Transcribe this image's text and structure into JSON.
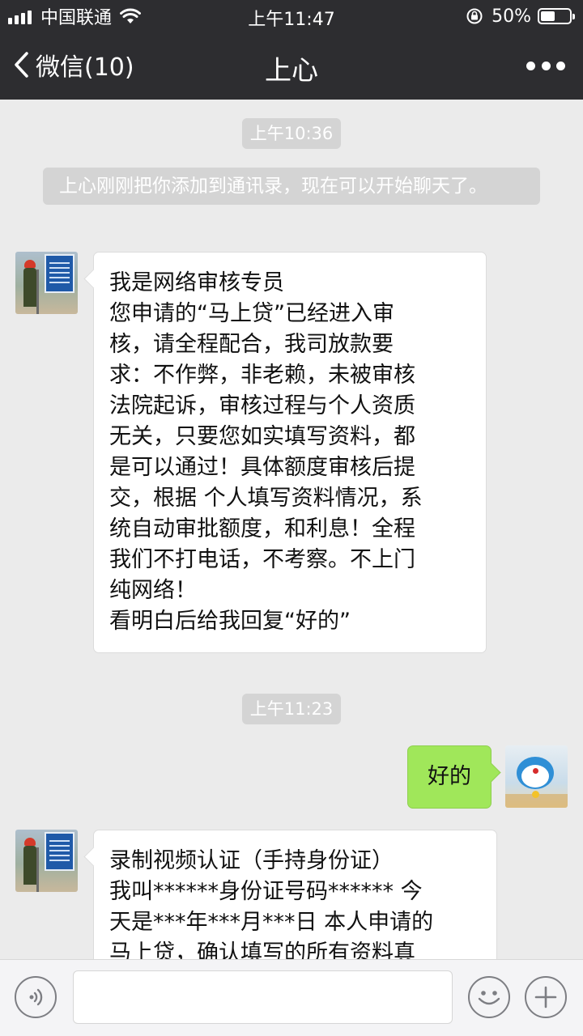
{
  "status_bar": {
    "carrier": "中国联通",
    "time": "上午11:47",
    "battery_percent": "50%",
    "battery_level": 0.5,
    "icons": [
      "signal-icon",
      "wifi-icon",
      "rotation-lock-icon",
      "battery-icon"
    ]
  },
  "nav": {
    "back_label": "微信(10)",
    "title": "上心",
    "icons": [
      "back-chevron-icon",
      "more-icon"
    ]
  },
  "chat": {
    "timestamp_1": "上午10:36",
    "system_message": "上心刚刚把你添加到通讯录，现在可以开始聊天了。",
    "message_1": {
      "sender": "上心",
      "lines": [
        "我是网络审核专员",
        "您申请的“马上贷”已经进入审",
        "核，请全程配合，我司放款要",
        "求：不作弊，非老赖，未被审核",
        "法院起诉，审核过程与个人资质",
        "无关，只要您如实填写资料，都",
        "是可以通过！具体额度审核后提",
        "交，根据 个人填写资料情况，系",
        "统自动审批额度，和利息！全程",
        "我们不打电话，不考察。不上门",
        "纯网络！",
        "看明白后给我回复“好的”"
      ]
    },
    "timestamp_2": "上午11:23",
    "message_2": {
      "sender": "me",
      "text": "好的"
    },
    "message_3": {
      "sender": "上心",
      "lines": [
        "录制视频认证（手持身份证）",
        "我叫******身份证号码******  今",
        "天是***年***月***日   本人申请的",
        "马上贷，确认填写的所有资料真"
      ]
    }
  },
  "input_bar": {
    "value": "",
    "icons": [
      "voice-icon",
      "emoji-icon",
      "plus-icon"
    ]
  },
  "colors": {
    "header_bg": "#2d2d30",
    "chat_bg": "#ebebeb",
    "outgoing_bubble": "#a0e75a",
    "incoming_bubble": "#ffffff",
    "timestamp_bg": "#d4d4d4"
  }
}
